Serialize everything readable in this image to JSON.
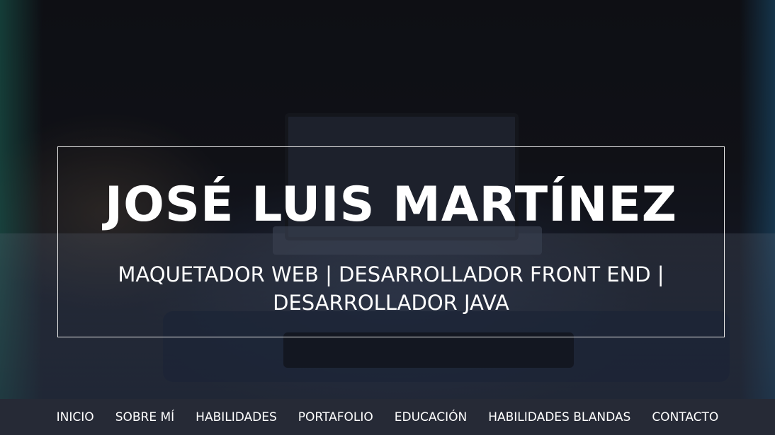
{
  "hero": {
    "name": "JOSÉ LUIS MARTÍNEZ",
    "roles_line1": "MAQUETADOR WEB | DESARROLLADOR FRONT END |",
    "roles_line2": "DESARROLLADOR JAVA"
  },
  "nav": {
    "items": [
      {
        "label": "INICIO"
      },
      {
        "label": "SOBRE MÍ"
      },
      {
        "label": "HABILIDADES"
      },
      {
        "label": "PORTAFOLIO"
      },
      {
        "label": "EDUCACIÓN"
      },
      {
        "label": "HABILIDADES BLANDAS"
      },
      {
        "label": "CONTACTO"
      }
    ]
  },
  "colors": {
    "nav_background": "#262a36",
    "text": "#ffffff",
    "border": "#e8e8e8"
  }
}
